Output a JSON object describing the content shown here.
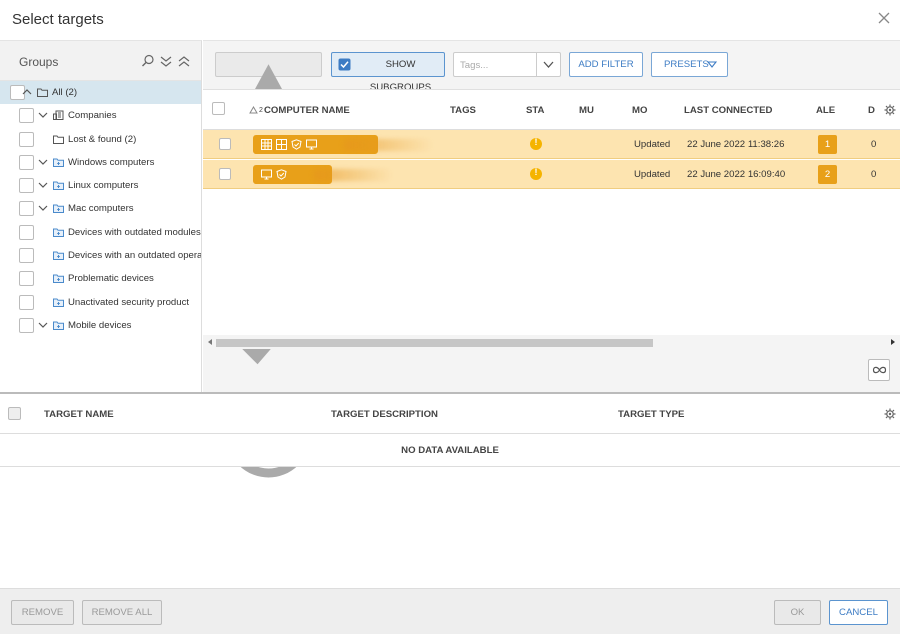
{
  "dialog": {
    "title": "Select targets"
  },
  "groups": {
    "title": "Groups",
    "items": [
      {
        "label": "All (2)",
        "expand": "up",
        "icon": "folder-icon",
        "selected": true
      },
      {
        "label": "Companies",
        "expand": "down",
        "icon": "building-icon"
      },
      {
        "label": "Lost & found (2)",
        "expand": "",
        "icon": "folder-icon"
      },
      {
        "label": "Windows computers",
        "expand": "down",
        "icon": "dynamic-folder-icon"
      },
      {
        "label": "Linux computers",
        "expand": "down",
        "icon": "dynamic-folder-icon"
      },
      {
        "label": "Mac computers",
        "expand": "down",
        "icon": "dynamic-folder-icon"
      },
      {
        "label": "Devices with outdated modules",
        "expand": "",
        "icon": "dynamic-folder-icon"
      },
      {
        "label": "Devices with an outdated operat",
        "expand": "",
        "icon": "dynamic-folder-icon"
      },
      {
        "label": "Problematic devices",
        "expand": "",
        "icon": "dynamic-folder-icon"
      },
      {
        "label": "Unactivated security product",
        "expand": "",
        "icon": "dynamic-folder-icon"
      },
      {
        "label": "Mobile devices",
        "expand": "down",
        "icon": "dynamic-folder-icon"
      }
    ]
  },
  "toolbar": {
    "show_subgroups": "SHOW SUBGROUPS",
    "tags_placeholder": "Tags...",
    "add_filter": "ADD FILTER",
    "presets": "PRESETS"
  },
  "computers": {
    "columns": {
      "sort_index": "2",
      "name": "COMPUTER NAME",
      "tags": "TAGS",
      "status": "STA",
      "muted": "MU",
      "modules": "MO",
      "last_connected": "LAST CONNECTED",
      "alerts": "ALE",
      "detections": "D"
    },
    "rows": [
      {
        "icons": [
          "grid-icon",
          "grid-icon",
          "shield-check-icon",
          "monitor-icon"
        ],
        "modules": "Updated",
        "last_connected": "22 June 2022 11:38:26",
        "alerts": "1",
        "detections": "0"
      },
      {
        "icons": [
          "monitor-icon",
          "shield-check-icon"
        ],
        "modules": "Updated",
        "last_connected": "22 June 2022 16:09:40",
        "alerts": "2",
        "detections": "0"
      }
    ]
  },
  "targets": {
    "columns": {
      "name": "TARGET NAME",
      "description": "TARGET DESCRIPTION",
      "type": "TARGET TYPE"
    },
    "empty": "NO DATA AVAILABLE"
  },
  "footer": {
    "remove": "REMOVE",
    "remove_all": "REMOVE ALL",
    "ok": "OK",
    "cancel": "CANCEL"
  },
  "colors": {
    "row_highlight": "#fde4b0",
    "accent_orange": "#e8a019",
    "accent_blue": "#3d7cc4",
    "selected_group": "#d6e6ef"
  }
}
